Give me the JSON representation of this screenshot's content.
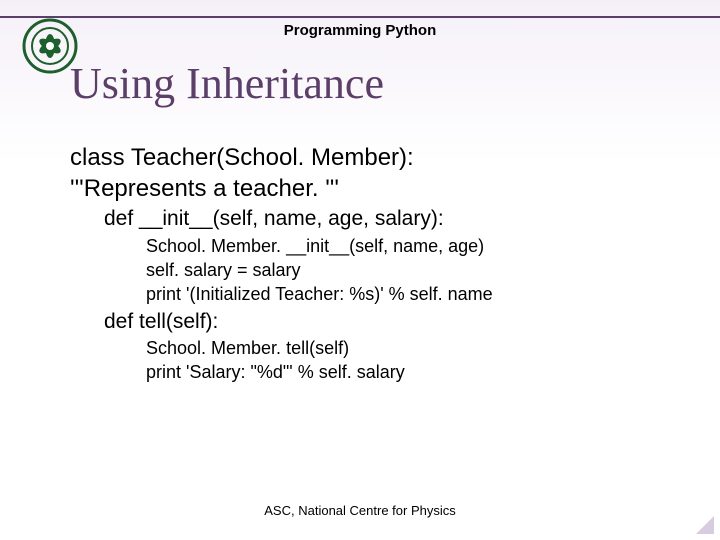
{
  "header": {
    "subtitle": "Programming Python",
    "title": "Using Inheritance"
  },
  "code": {
    "l1": "class Teacher(School. Member):",
    "l2": "'''Represents a teacher. '''",
    "l3": "def __init__(self, name, age, salary):",
    "l4": "School. Member. __init__(self, name, age)",
    "l5": "self. salary = salary",
    "l6": "print '(Initialized Teacher: %s)' % self. name",
    "l7": "def tell(self):",
    "l8": "School. Member. tell(self)",
    "l9": "print 'Salary: \"%d\"' % self. salary"
  },
  "footer": {
    "text": "ASC, National Centre for Physics"
  }
}
